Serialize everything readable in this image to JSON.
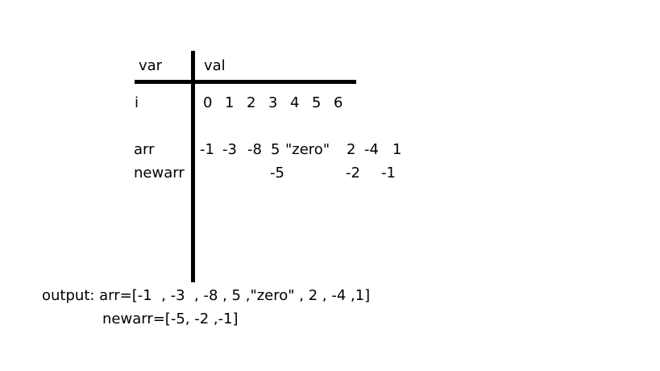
{
  "table": {
    "header": {
      "var_label": "var",
      "val_label": "val"
    },
    "index_row": {
      "label": "i",
      "values": [
        "0",
        "1",
        "2",
        "3",
        "4",
        "5",
        "6"
      ]
    },
    "arr_row": {
      "label": "arr",
      "values": [
        "-1",
        "-3",
        "-8",
        "5",
        "\"zero\"",
        "2",
        "-4",
        "1"
      ]
    },
    "newarr_row": {
      "label": "newarr",
      "values": [
        "-5",
        "-2",
        "-1"
      ]
    }
  },
  "output": {
    "line1": "output: arr=[-1  , -3  , -8 , 5 ,\"zero\" , 2 , -4 ,1]",
    "line2": "newarr=[-5, -2 ,-1]"
  }
}
